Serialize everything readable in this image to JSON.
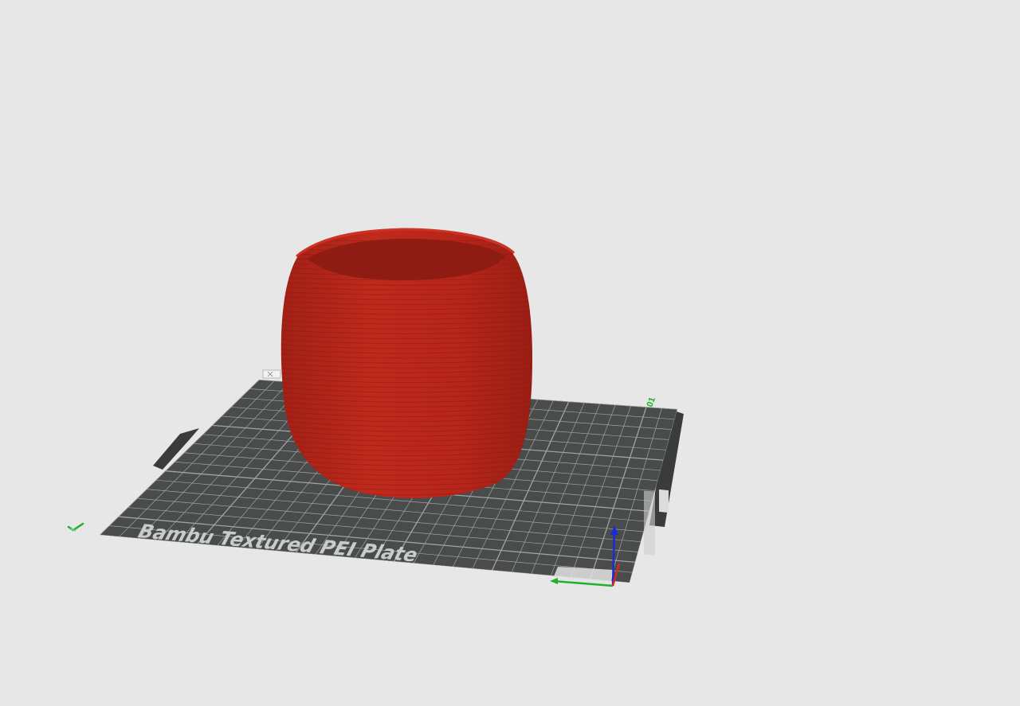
{
  "viewport": {
    "background_color": "#e7e7e7"
  },
  "build_plate": {
    "label": "Bambu Textured PEI Plate",
    "plate_number": "01",
    "surface_color": "#4a4c4c",
    "grid_color": "#9fa3a3",
    "edge_color": "#3a3c3c",
    "label_color": "#c9cccc"
  },
  "model": {
    "color": "#b8261a",
    "shade_color": "#8e1c12",
    "highlight_color": "#cc3324",
    "shape": "vase"
  },
  "axes": {
    "x_color": "#d42a1a",
    "y_color": "#22b02a",
    "z_color": "#1a2ad4"
  },
  "icons": {
    "origin_marker": "green-check-icon",
    "plate_tools": "plate-toolbar-icon"
  }
}
